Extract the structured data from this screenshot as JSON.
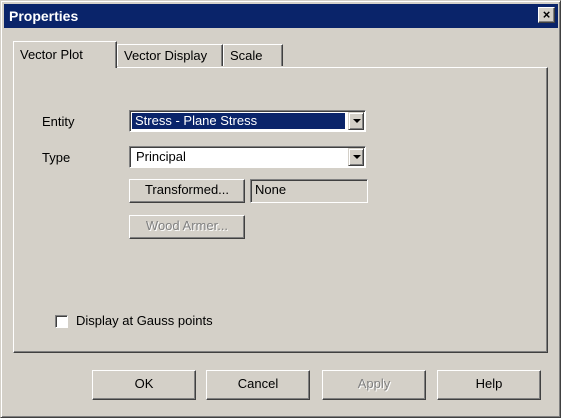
{
  "window": {
    "title": "Properties",
    "close_glyph": "×"
  },
  "tabs": [
    {
      "label": "Vector Plot",
      "active": true
    },
    {
      "label": "Vector Display",
      "active": false
    },
    {
      "label": "Scale",
      "active": false
    }
  ],
  "form": {
    "entity_label": "Entity",
    "entity_value": "Stress - Plane Stress",
    "type_label": "Type",
    "type_value": "Principal",
    "transformed_button": "Transformed...",
    "transformed_value": "None",
    "wood_armer_button": "Wood Armer...",
    "gauss_checkbox_label": "Display at Gauss points",
    "gauss_checked": false
  },
  "buttons": {
    "ok": "OK",
    "cancel": "Cancel",
    "apply": "Apply",
    "help": "Help"
  },
  "colors": {
    "face": "#d4d0c8",
    "titlebar": "#0a246a",
    "selection": "#0a246a"
  }
}
